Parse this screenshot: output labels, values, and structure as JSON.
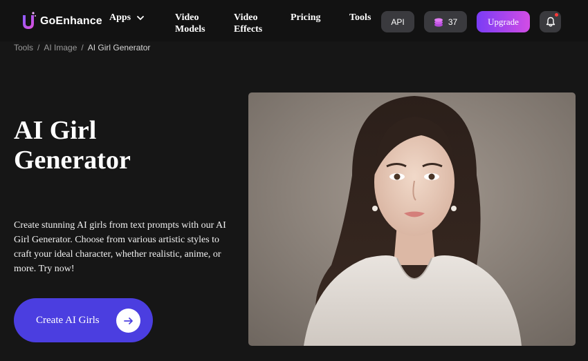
{
  "header": {
    "logo_text": "GoEnhance",
    "nav": {
      "apps": "Apps",
      "video_models_1": "Video",
      "video_models_2": "Models",
      "video_effects_1": "Video",
      "video_effects_2": "Effects",
      "pricing": "Pricing",
      "tools": "Tools"
    },
    "api_label": "API",
    "credits": "37",
    "upgrade_label": "Upgrade"
  },
  "breadcrumb": {
    "items": [
      "Tools",
      "AI Image",
      "AI Girl Generator"
    ],
    "separator": "/"
  },
  "hero": {
    "title_line1": "AI Girl",
    "title_line2": "Generator",
    "description": "Create stunning AI girls from text prompts with our AI Girl Generator. Choose from various artistic styles to craft your ideal character, whether realistic, anime, or more. Try now!",
    "cta_label": "Create AI Girls"
  },
  "colors": {
    "background": "#161616",
    "header": "#121212",
    "cta": "#4b3ee0",
    "upgrade_start": "#7a3cf5",
    "upgrade_end": "#d24de5",
    "notification_dot": "#ff3a3a"
  },
  "icons": [
    "chevron-down-icon",
    "coin-stack-icon",
    "bell-icon",
    "arrow-right-icon"
  ]
}
